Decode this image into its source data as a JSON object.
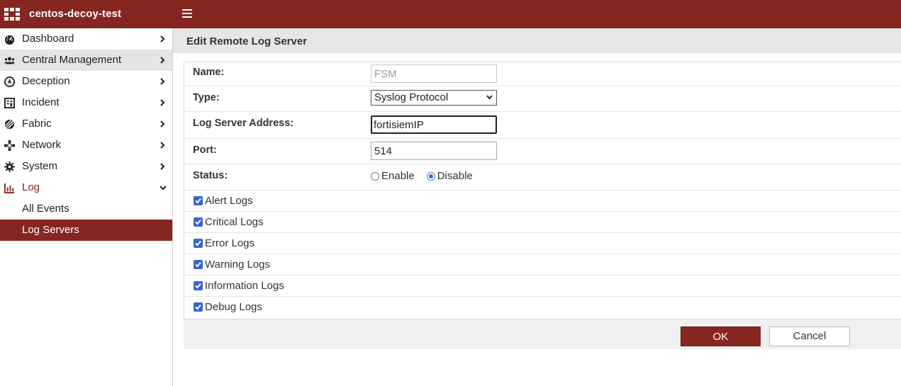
{
  "app": {
    "title": "centos-decoy-test"
  },
  "sidebar": {
    "items": [
      {
        "label": "Dashboard",
        "icon": "dashboard-gauge-icon"
      },
      {
        "label": "Central Management",
        "icon": "users-icon"
      },
      {
        "label": "Deception",
        "icon": "deception-icon"
      },
      {
        "label": "Incident",
        "icon": "incident-icon"
      },
      {
        "label": "Fabric",
        "icon": "fabric-icon"
      },
      {
        "label": "Network",
        "icon": "network-icon"
      },
      {
        "label": "System",
        "icon": "gear-icon"
      },
      {
        "label": "Log",
        "icon": "bar-chart-icon"
      }
    ],
    "log_sub_items": [
      {
        "label": "All Events"
      },
      {
        "label": "Log Servers"
      }
    ]
  },
  "page": {
    "title": "Edit Remote Log Server"
  },
  "form": {
    "name_label": "Name:",
    "name_value": "FSM",
    "type_label": "Type:",
    "type_value": "Syslog Protocol",
    "address_label": "Log Server Address:",
    "address_value": "fortisiemIP",
    "port_label": "Port:",
    "port_value": "514",
    "status_label": "Status:",
    "status_enable": "Enable",
    "status_disable": "Disable",
    "status_selected": "Disable",
    "log_levels": [
      {
        "label": "Alert Logs",
        "checked": true
      },
      {
        "label": "Critical Logs",
        "checked": true
      },
      {
        "label": "Error Logs",
        "checked": true
      },
      {
        "label": "Warning Logs",
        "checked": true
      },
      {
        "label": "Information Logs",
        "checked": true
      },
      {
        "label": "Debug Logs",
        "checked": true
      }
    ]
  },
  "buttons": {
    "ok": "OK",
    "cancel": "Cancel"
  },
  "colors": {
    "brand": "#862620",
    "checkbox": "#3566d6",
    "header_bg": "#e6e6e6"
  }
}
